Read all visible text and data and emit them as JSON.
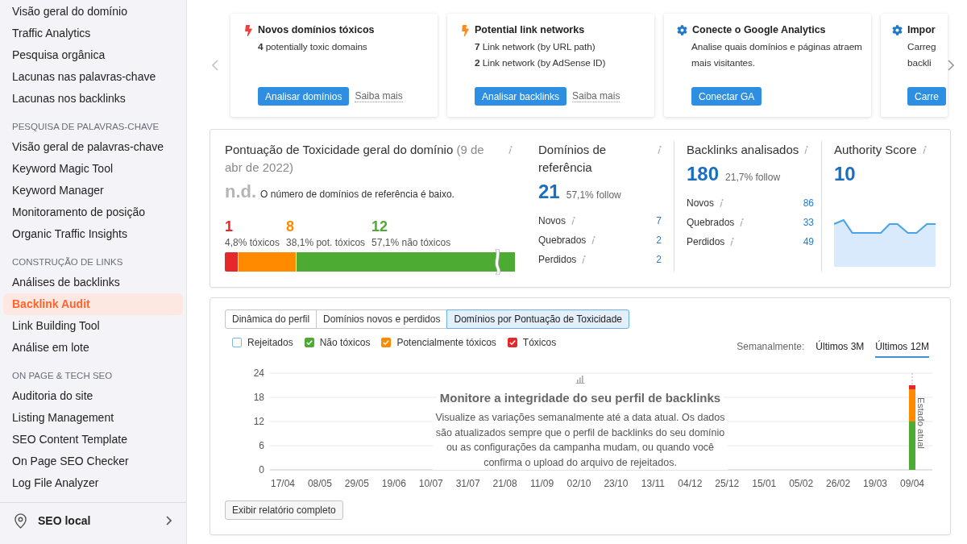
{
  "sidebar": {
    "sections": [
      {
        "items": [
          {
            "label": "Visão geral do domínio",
            "selected": false
          },
          {
            "label": "Traffic Analytics",
            "selected": false
          },
          {
            "label": "Pesquisa orgânica",
            "selected": false
          },
          {
            "label": "Lacunas nas palavras-chave",
            "selected": false
          },
          {
            "label": "Lacunas nos backlinks",
            "selected": false
          }
        ]
      },
      {
        "heading": "PESQUISA DE PALAVRAS-CHAVE",
        "items": [
          {
            "label": "Visão geral de palavras-chave",
            "selected": false
          },
          {
            "label": "Keyword Magic Tool",
            "selected": false
          },
          {
            "label": "Keyword Manager",
            "selected": false
          },
          {
            "label": "Monitoramento de posição",
            "selected": false
          },
          {
            "label": "Organic Traffic Insights",
            "selected": false
          }
        ]
      },
      {
        "heading": "CONSTRUÇÃO DE LINKS",
        "items": [
          {
            "label": "Análises de backlinks",
            "selected": false
          },
          {
            "label": "Backlink Audit",
            "selected": true
          },
          {
            "label": "Link Building Tool",
            "selected": false
          },
          {
            "label": "Análise em lote",
            "selected": false
          }
        ]
      },
      {
        "heading": "ON PAGE & TECH SEO",
        "items": [
          {
            "label": "Auditoria do site",
            "selected": false
          },
          {
            "label": "Listing Management",
            "selected": false
          },
          {
            "label": "SEO Content Template",
            "selected": false
          },
          {
            "label": "On Page SEO Checker",
            "selected": false
          },
          {
            "label": "Log File Analyzer",
            "selected": false
          }
        ]
      }
    ],
    "footer_item": {
      "label": "SEO local"
    }
  },
  "cards": [
    {
      "kind": "alert",
      "color": "#f0403c",
      "title": "Novos domínios tóxicos",
      "lines": [
        "**4** potentially toxic domains"
      ],
      "button": "Analisar domínios",
      "link": "Saiba mais"
    },
    {
      "kind": "alert",
      "color": "#ff8c1a",
      "title": "Potential link networks",
      "lines": [
        "**7** Link network (by URL path)",
        "**2** Link network (by AdSense ID)"
      ],
      "button": "Analisar backlinks",
      "link": "Saiba mais"
    },
    {
      "kind": "setup",
      "color": "#1f78c8",
      "title": "Conecte o Google Analytics",
      "lines": [
        "Analise quais domínios e páginas atraem mais visitantes."
      ],
      "button": "Conectar GA"
    },
    {
      "kind": "setup",
      "color": "#1f78c8",
      "title": "Impor",
      "lines": [
        "Carreg",
        "backli"
      ],
      "button": "Carre"
    }
  ],
  "toxicity": {
    "title": "Pontuação de Toxicidade geral do domínio",
    "date": "(9 de abr de 2022)",
    "score": "n.d.",
    "note": "O número de domínios de referência é baixo.",
    "breakdown": [
      {
        "value": "1",
        "label": "4,8% tóxicos",
        "color": "#e5282c",
        "level": 0.047
      },
      {
        "value": "8",
        "label": "38,1% pot. tóxicos",
        "color": "#ff8a00",
        "level": 0.2
      },
      {
        "value": "12",
        "label": "57,1% não tóxicos",
        "color": "#4dab34",
        "level": 0.753
      }
    ]
  },
  "metrics": [
    {
      "title": "Domínios de referência",
      "value": "21",
      "subtitle": "57,1% follow",
      "rows": [
        {
          "label": "Novos",
          "value": "7"
        },
        {
          "label": "Quebrados",
          "value": "2"
        },
        {
          "label": "Perdidos",
          "value": "2"
        }
      ]
    },
    {
      "title": "Backlinks analisados",
      "value": "180",
      "subtitle": "21,7% follow",
      "rows": [
        {
          "label": "Novos",
          "value": "86"
        },
        {
          "label": "Quebrados",
          "value": "33"
        },
        {
          "label": "Perdidos",
          "value": "49"
        }
      ]
    }
  ],
  "authority": {
    "title": "Authority Score",
    "value": "10"
  },
  "chart_panel": {
    "tabs": [
      {
        "label": "Dinâmica do perfil",
        "selected": false
      },
      {
        "label": "Domínios novos e perdidos",
        "selected": false
      },
      {
        "label": "Domínios por Pontuação de Toxicidade",
        "selected": true
      }
    ],
    "legend": [
      {
        "checked": false
      },
      {
        "checked": true
      },
      {
        "checked": true
      },
      {
        "checked": true
      }
    ],
    "range": {
      "label": "Semanalmente:",
      "options": [
        {
          "label": "Últimos 3M",
          "selected": false
        },
        {
          "label": "Últimos 12M",
          "selected": true
        }
      ]
    },
    "chart_data": {
      "type": "bar",
      "stacked": true,
      "grid": true,
      "categories": [
        "17/04",
        "08/05",
        "29/05",
        "19/06",
        "10/07",
        "31/07",
        "21/08",
        "11/09",
        "02/10",
        "23/10",
        "13/11",
        "04/12",
        "25/12",
        "15/01",
        "05/02",
        "26/02",
        "19/03",
        "09/04"
      ],
      "series": [
        {
          "name": "Rejeitados",
          "color": "#7fb6e8",
          "values": [
            null,
            null,
            null,
            null,
            null,
            null,
            null,
            null,
            null,
            null,
            null,
            null,
            null,
            null,
            null,
            null,
            null,
            null
          ]
        },
        {
          "name": "Não tóxicos",
          "color": "#4dab34",
          "values": [
            null,
            null,
            null,
            null,
            null,
            null,
            null,
            null,
            null,
            null,
            null,
            null,
            null,
            null,
            null,
            null,
            null,
            12
          ]
        },
        {
          "name": "Potencialmente tóxicos",
          "color": "#ff8a00",
          "values": [
            null,
            null,
            null,
            null,
            null,
            null,
            null,
            null,
            null,
            null,
            null,
            null,
            null,
            null,
            null,
            null,
            null,
            8
          ]
        },
        {
          "name": "Tóxicos",
          "color": "#e5282c",
          "values": [
            null,
            null,
            null,
            null,
            null,
            null,
            null,
            null,
            null,
            null,
            null,
            null,
            null,
            null,
            null,
            null,
            null,
            1
          ]
        }
      ],
      "ylim": [
        0,
        24
      ],
      "yticks": [
        {
          "value": 0,
          "label": "0"
        },
        {
          "value": 6,
          "label": "6"
        },
        {
          "value": 12,
          "label": "12"
        },
        {
          "value": 18,
          "label": "18"
        },
        {
          "value": 24,
          "label": "24"
        }
      ],
      "annotations": [
        {
          "x": "09/04",
          "text": "Estado atual"
        }
      ]
    },
    "empty_state": {
      "title": "Monitore a integridade do seu perfil de backlinks",
      "text": "Visualize as variações semanalmente até a data atual. Os dados são atualizados sempre que o perfil de backlinks do seu domínio ou as configurações da campanha mudam, ou quando você confirma o upload do arquivo de rejeitados."
    },
    "button": "Exibir relatório completo"
  }
}
